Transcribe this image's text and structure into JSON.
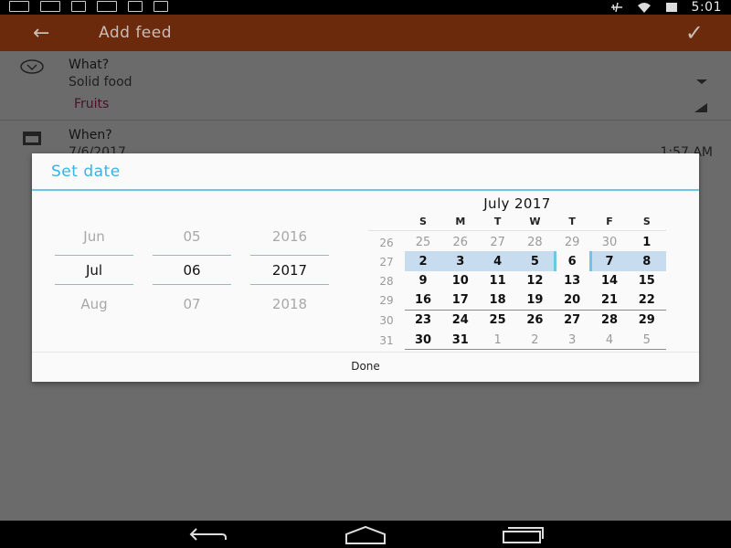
{
  "status_bar": {
    "time": "5:01",
    "left_icons": [
      "nidhi-app-icon",
      "message-icon",
      "download-icon",
      "youtube-icon",
      "inbox-icon",
      "barcode-icon"
    ],
    "right_icons": [
      "airplane-icon",
      "wifi-icon",
      "battery-icon"
    ]
  },
  "app_bar": {
    "title": "Add feed",
    "back_icon": "arrow-back-icon",
    "confirm_icon": "check-icon",
    "color": "#e8621d"
  },
  "form": {
    "what_label": "What?",
    "what_value": "Solid food",
    "what_sub": "Fruits",
    "when_label": "When?",
    "when_date": "7/6/2017",
    "when_time": "1:57 AM"
  },
  "dialog": {
    "title": "Set date",
    "accent": "#33b5e5",
    "picker": {
      "month": {
        "prev": "Jun",
        "current": "Jul",
        "next": "Aug"
      },
      "day": {
        "prev": "05",
        "current": "06",
        "next": "07"
      },
      "year": {
        "prev": "2016",
        "current": "2017",
        "next": "2018"
      }
    },
    "calendar": {
      "title": "July 2017",
      "weekdays": [
        "S",
        "M",
        "T",
        "W",
        "T",
        "F",
        "S"
      ],
      "weeks": [
        {
          "num": "26",
          "days": [
            "25",
            "26",
            "27",
            "28",
            "29",
            "30",
            "1"
          ]
        },
        {
          "num": "27",
          "days": [
            "2",
            "3",
            "4",
            "5",
            "6",
            "7",
            "8"
          ]
        },
        {
          "num": "28",
          "days": [
            "9",
            "10",
            "11",
            "12",
            "13",
            "14",
            "15"
          ]
        },
        {
          "num": "29",
          "days": [
            "16",
            "17",
            "18",
            "19",
            "20",
            "21",
            "22"
          ]
        },
        {
          "num": "30",
          "days": [
            "23",
            "24",
            "25",
            "26",
            "27",
            "28",
            "29"
          ]
        },
        {
          "num": "31",
          "days": [
            "30",
            "31",
            "1",
            "2",
            "3",
            "4",
            "5"
          ]
        }
      ],
      "selected_day": "6"
    },
    "done_label": "Done"
  }
}
